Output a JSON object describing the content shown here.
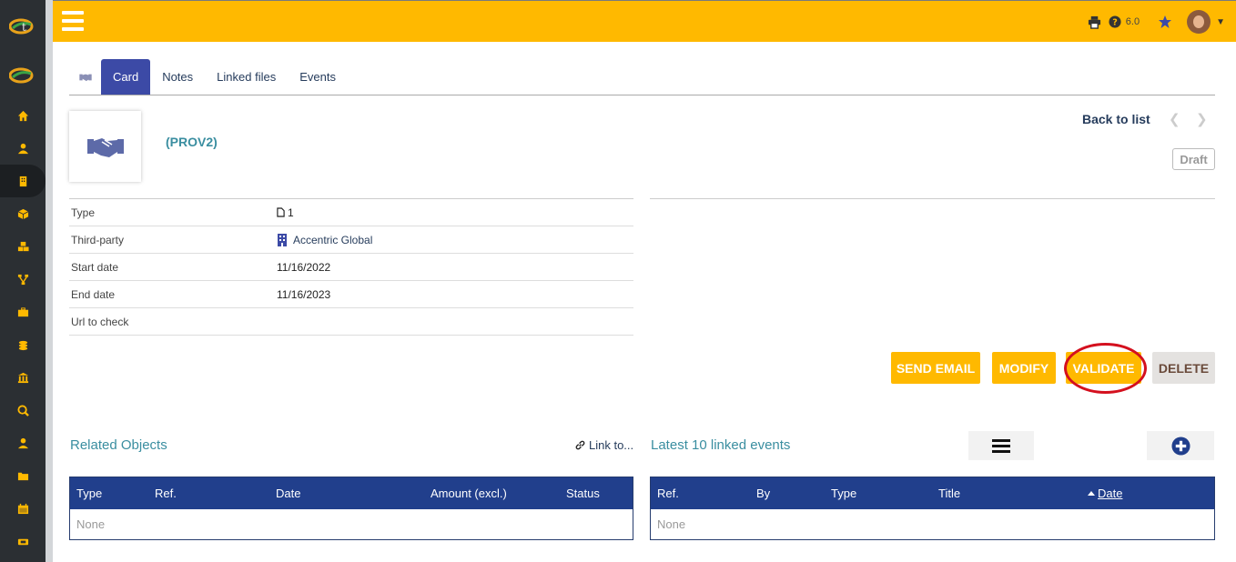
{
  "sidebar": {
    "icons": [
      "logo-icon",
      "logo-icon",
      "home-icon",
      "user-icon",
      "building-icon",
      "cube-icon",
      "cubes-icon",
      "project-icon",
      "briefcase-icon",
      "coins-icon",
      "bank-icon",
      "search-dollar-icon",
      "user-tie-icon",
      "folder-icon",
      "calendar-icon",
      "ticket-icon"
    ],
    "active": "building-icon"
  },
  "topbar": {
    "version": "6.0",
    "icons": [
      "print-icon",
      "help-icon",
      "star-icon",
      "avatar"
    ]
  },
  "tabs": [
    {
      "label": "Card",
      "active": true
    },
    {
      "label": "Notes",
      "active": false
    },
    {
      "label": "Linked files",
      "active": false
    },
    {
      "label": "Events",
      "active": false
    }
  ],
  "card": {
    "ref": "(PROV2)",
    "back_to_list": "Back to list",
    "status": "Draft"
  },
  "fields": [
    {
      "label": "Type",
      "value": "1",
      "icon": "file-icon"
    },
    {
      "label": "Third-party",
      "value": "Accentric Global",
      "icon": "building-icon"
    },
    {
      "label": "Start date",
      "value": "11/16/2022"
    },
    {
      "label": "End date",
      "value": "11/16/2023"
    },
    {
      "label": "Url to check",
      "value": ""
    }
  ],
  "actions": {
    "send_email": "SEND EMAIL",
    "modify": "MODIFY",
    "validate": "VALIDATE",
    "delete": "DELETE"
  },
  "related": {
    "title": "Related Objects",
    "link_to": "Link to...",
    "columns": [
      "Type",
      "Ref.",
      "Date",
      "Amount (excl.)",
      "Status"
    ],
    "empty": "None"
  },
  "events": {
    "title": "Latest 10 linked events",
    "columns": [
      "Ref.",
      "By",
      "Type",
      "Title",
      "Date"
    ],
    "empty": "None"
  },
  "colors": {
    "topbar": "#ffb900",
    "tab_active": "#3c4aa6",
    "table_header": "#213f8c",
    "accent_teal": "#3a8ea0",
    "highlight": "#d4101e"
  }
}
